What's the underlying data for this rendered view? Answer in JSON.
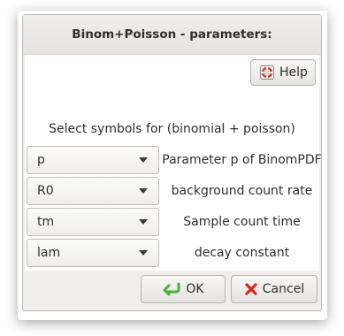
{
  "dialog": {
    "title": "Binom+Poisson - parameters:"
  },
  "help": {
    "label": "Help",
    "icon": "help-lifebuoy-icon"
  },
  "prompt": "Select symbols for (binomial + poisson)",
  "rows": [
    {
      "selected": "p",
      "label": "Parameter p of BinomPDF"
    },
    {
      "selected": "R0",
      "label": "background count rate"
    },
    {
      "selected": "tm",
      "label": "Sample count time"
    },
    {
      "selected": "lam",
      "label": "decay constant"
    }
  ],
  "buttons": {
    "ok_label": "OK",
    "ok_icon": "ok-arrow-icon",
    "cancel_label": "Cancel",
    "cancel_icon": "cancel-x-icon"
  },
  "colors": {
    "ok_icon": "#4caf3a",
    "cancel_icon": "#d9261c",
    "help_icon": "#c0392b"
  }
}
